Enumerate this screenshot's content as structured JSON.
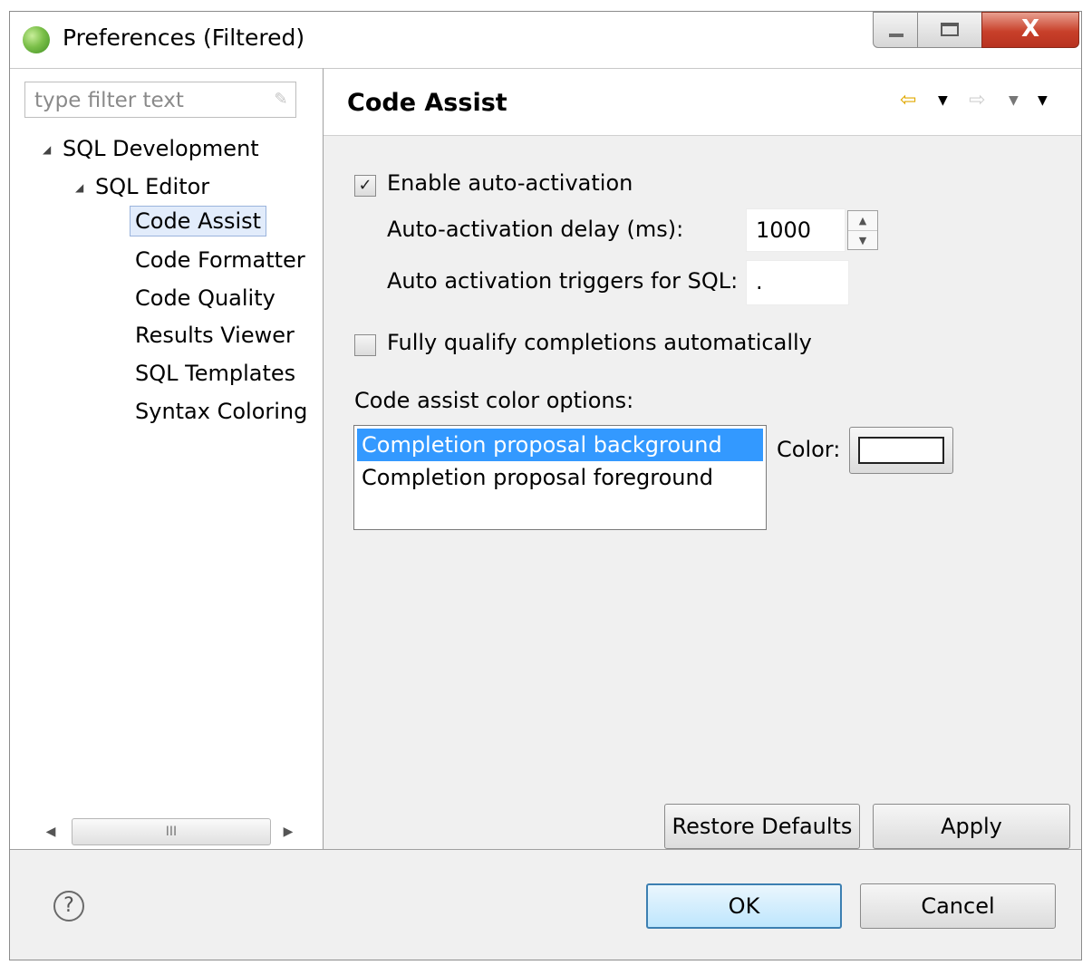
{
  "window": {
    "title": "Preferences (Filtered)",
    "app_icon": "eclipse-sphere-icon",
    "controls": {
      "minimize": "minimize-icon",
      "maximize": "maximize-icon",
      "close_glyph": "X"
    }
  },
  "filter": {
    "placeholder": "type filter text",
    "value": "",
    "clear_icon": "clear-icon"
  },
  "tree": {
    "expander_glyph": "◢",
    "root": "SQL Development",
    "child": "SQL Editor",
    "items": [
      "Code Assist",
      "Code Formatter",
      "Code Quality",
      "Results Viewer",
      "SQL Templates",
      "Syntax Coloring"
    ],
    "selected": "Code Assist"
  },
  "scrollbar": {
    "left": "◀",
    "right": "▶",
    "grip": "III"
  },
  "page": {
    "title": "Code Assist",
    "nav_icons": [
      "back-arrow-icon",
      "back-dropdown-icon",
      "forward-arrow-icon",
      "forward-dropdown-icon",
      "view-menu-icon"
    ],
    "enable_auto_activation": {
      "label": "Enable auto-activation",
      "checked": true
    },
    "delay": {
      "label": "Auto-activation delay (ms):",
      "value": "1000"
    },
    "triggers": {
      "label": "Auto activation triggers for SQL:",
      "value": "."
    },
    "fully_qualify": {
      "label": "Fully qualify completions automatically",
      "checked": false
    },
    "color_options": {
      "label": "Code assist color options:",
      "items": [
        "Completion proposal background",
        "Completion proposal foreground"
      ],
      "selected_index": 0,
      "color_label": "Color:",
      "swatch_color": "#ffffff"
    },
    "restore_defaults": "Restore Defaults",
    "apply": "Apply"
  },
  "footer": {
    "help_icon": "help-icon",
    "ok": "OK",
    "cancel": "Cancel"
  },
  "colors": {
    "selection": "#3399ff",
    "tree_selection": "#e2ecfb",
    "close_button": "#c8402a"
  }
}
